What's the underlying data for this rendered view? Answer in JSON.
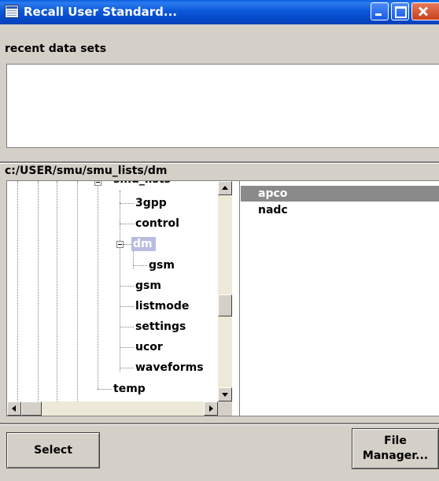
{
  "window": {
    "title": "Recall User Standard...",
    "controls": [
      "minimize-icon",
      "maximize-icon",
      "close-icon"
    ]
  },
  "recent": {
    "label": "recent data sets",
    "items": []
  },
  "path": {
    "label": "c:/USER/smu/smu_lists/dm"
  },
  "tree": {
    "partial_top": "smu_lists",
    "items": [
      {
        "label": "3gpp"
      },
      {
        "label": "control"
      },
      {
        "label": "dm",
        "selected": true,
        "expanded": true
      },
      {
        "label": "gsm"
      },
      {
        "label": "gsm"
      },
      {
        "label": "listmode"
      },
      {
        "label": "settings"
      },
      {
        "label": "ucor"
      },
      {
        "label": "waveforms"
      },
      {
        "label": "temp"
      }
    ]
  },
  "files": {
    "items": [
      {
        "label": "apco",
        "selected": true
      },
      {
        "label": "nadc",
        "selected": false
      }
    ]
  },
  "buttons": {
    "select": "Select",
    "file_manager_line1": "File",
    "file_manager_line2": "Manager..."
  },
  "colors": {
    "titlebar": "#0b58d8",
    "dialog_bg": "#d4d0c8",
    "tree_selection": "#b7bde0",
    "file_selection": "#8a8a8a"
  }
}
